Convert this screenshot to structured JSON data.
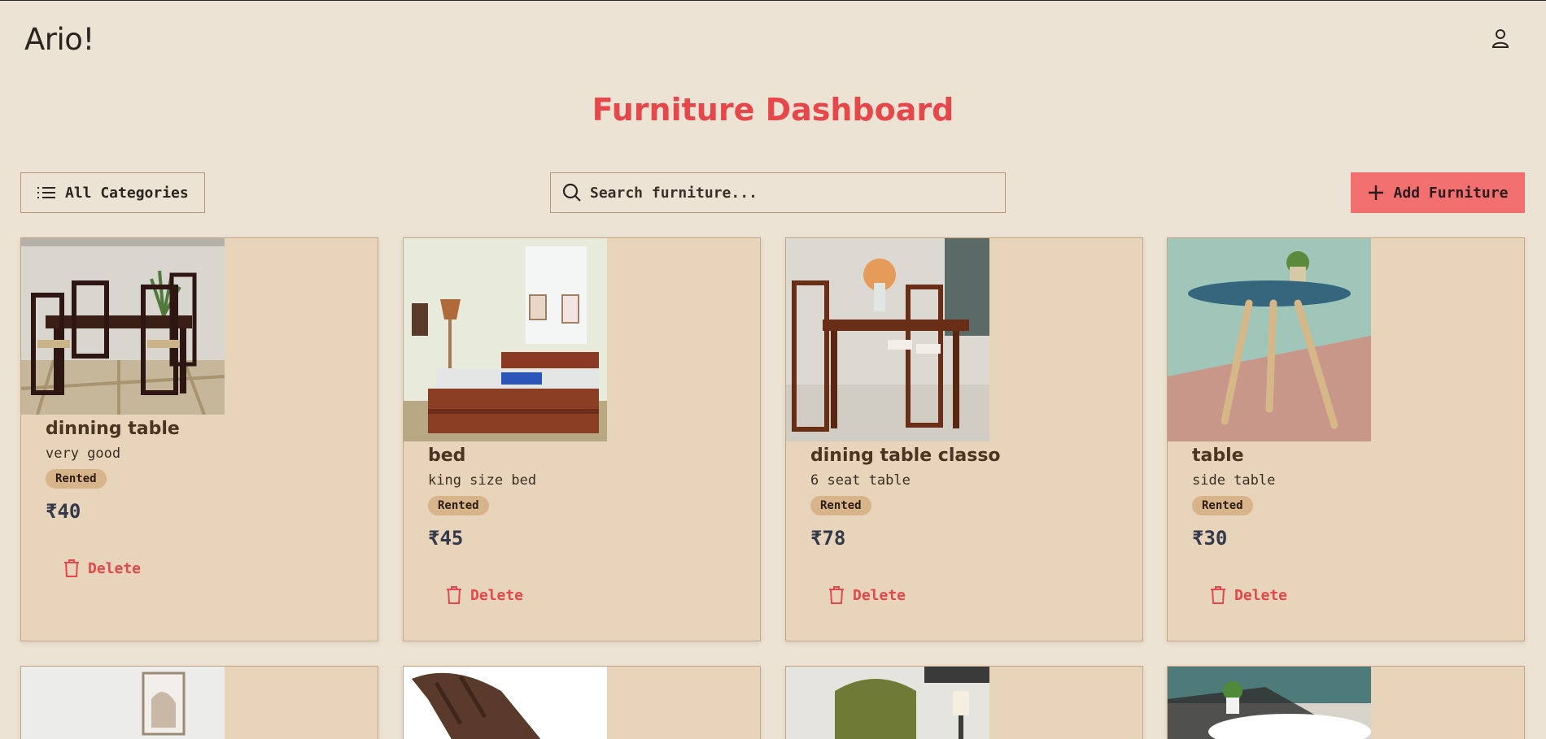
{
  "app": {
    "brand": "Ario!"
  },
  "page": {
    "title": "Furniture Dashboard"
  },
  "toolbar": {
    "categories_label": "All Categories",
    "search_placeholder": "Search furniture...",
    "search_value": "",
    "add_label": "Add Furniture"
  },
  "items": [
    {
      "name": "dinning table",
      "description": "very good",
      "status": "Rented",
      "price": "₹40",
      "delete_label": "Delete"
    },
    {
      "name": "bed",
      "description": "king size bed",
      "status": "Rented",
      "price": "₹45",
      "delete_label": "Delete"
    },
    {
      "name": "dining table classo",
      "description": "6 seat table",
      "status": "Rented",
      "price": "₹78",
      "delete_label": "Delete"
    },
    {
      "name": "table",
      "description": "side table",
      "status": "Rented",
      "price": "₹30",
      "delete_label": "Delete"
    }
  ],
  "colors": {
    "background": "#ede3d5",
    "card": "#e7d4ba",
    "accent": "#e5474a",
    "add_button": "#f16f6f",
    "badge": "#d8b48b",
    "border": "#b99673"
  },
  "icons": {
    "user": "user-icon",
    "list": "list-icon",
    "search": "search-icon",
    "plus": "plus-icon",
    "trash": "trash-icon"
  }
}
